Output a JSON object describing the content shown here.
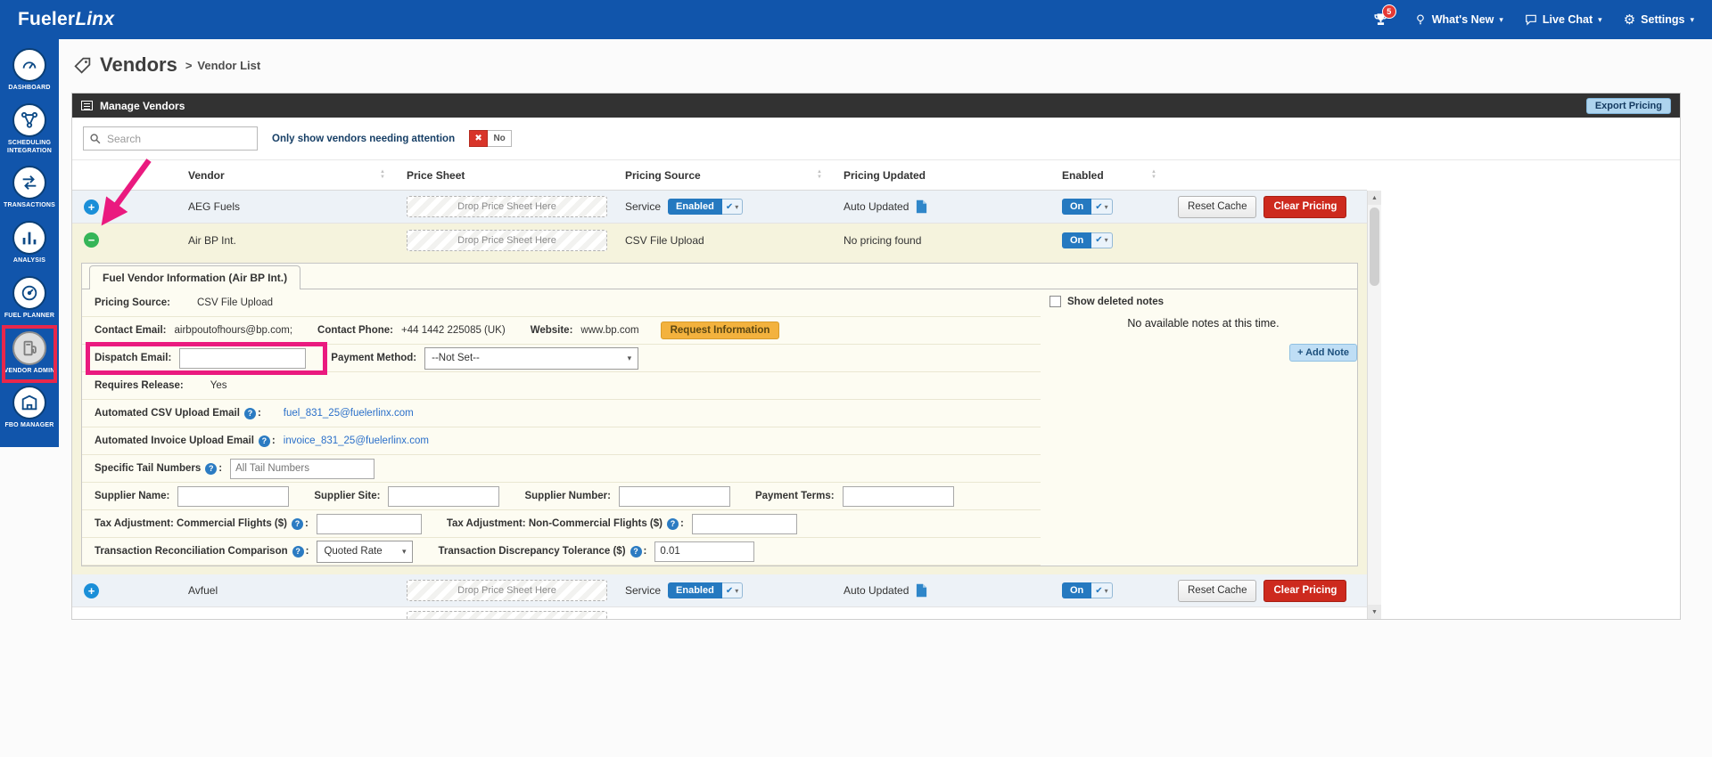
{
  "icons": {
    "sort_asc": "▲",
    "sort_desc": "▼",
    "caret": "▾",
    "check": "✔",
    "close": "✖",
    "plus": "+",
    "minus": "−",
    "help": "?",
    "gear": "⚙"
  },
  "annotations": {
    "color": "#ea1a7f"
  },
  "topbar": {
    "brand_bold": "Fueler",
    "brand_italic": "Linx",
    "badge_count": "5",
    "whats_new": "What's New",
    "live_chat": "Live Chat",
    "settings": "Settings"
  },
  "sidebar": {
    "items": [
      {
        "label": "DASHBOARD"
      },
      {
        "label": "SCHEDULING INTEGRATION"
      },
      {
        "label": "TRANSACTIONS"
      },
      {
        "label": "ANALYSIS"
      },
      {
        "label": "FUEL PLANNER"
      },
      {
        "label": "VENDOR ADMIN"
      },
      {
        "label": "FBO MANAGER"
      }
    ]
  },
  "breadcrumb": {
    "title": "Vendors",
    "separator": ">",
    "current": "Vendor List"
  },
  "manage": {
    "title": "Manage Vendors",
    "export_button": "Export Pricing",
    "search_placeholder": "Search",
    "attention_label": "Only show vendors needing attention",
    "attention_value": "No"
  },
  "table": {
    "headers": {
      "vendor": "Vendor",
      "price_sheet": "Price Sheet",
      "pricing_source": "Pricing Source",
      "pricing_updated": "Pricing Updated",
      "enabled": "Enabled"
    },
    "drop_zone_text": "Drop Price Sheet Here",
    "rows": [
      {
        "vendor": "AEG Fuels",
        "pricing_source": "Service",
        "source_badge": "Enabled",
        "pricing_updated": "Auto Updated",
        "enabled": "On",
        "reset_button": "Reset Cache",
        "clear_button": "Clear Pricing"
      },
      {
        "vendor": "Air BP Int.",
        "pricing_source": "CSV File Upload",
        "pricing_updated": "No pricing found",
        "enabled": "On"
      },
      {
        "vendor": "Avfuel",
        "pricing_source": "Service",
        "source_badge": "Enabled",
        "pricing_updated": "Auto Updated",
        "enabled": "On",
        "reset_button": "Reset Cache",
        "clear_button": "Clear Pricing"
      }
    ]
  },
  "detail": {
    "tab": "Fuel Vendor Information (Air BP Int.)",
    "colon": ":",
    "pricing_source_label": "Pricing Source:",
    "pricing_source_value": "CSV File Upload",
    "contact_email_label": "Contact Email:",
    "contact_email_value": "airbpoutofhours@bp.com;",
    "contact_phone_label": "Contact Phone:",
    "contact_phone_value": "+44 1442 225085 (UK)",
    "website_label": "Website:",
    "website_value": "www.bp.com",
    "request_button": "Request Information",
    "dispatch_email_label": "Dispatch Email:",
    "payment_method_label": "Payment Method:",
    "payment_method_value": "--Not Set--",
    "requires_release_label": "Requires Release:",
    "requires_release_value": "Yes",
    "auto_csv_label": "Automated CSV Upload Email",
    "auto_csv_value": "fuel_831_25@fuelerlinx.com",
    "auto_invoice_label": "Automated Invoice Upload Email",
    "auto_invoice_value": "invoice_831_25@fuelerlinx.com",
    "tail_label": "Specific Tail Numbers",
    "tail_placeholder": "All Tail Numbers",
    "supplier_name_label": "Supplier Name:",
    "supplier_site_label": "Supplier Site:",
    "supplier_number_label": "Supplier Number:",
    "payment_terms_label": "Payment Terms:",
    "tax_commercial_label": "Tax Adjustment: Commercial Flights ($)",
    "tax_non_commercial_label": "Tax Adjustment: Non-Commercial Flights ($)",
    "recon_label": "Transaction Reconciliation Comparison",
    "recon_value": "Quoted Rate",
    "tolerance_label": "Transaction Discrepancy Tolerance ($)",
    "tolerance_value": "0.01",
    "notes": {
      "show_deleted_label": "Show deleted notes",
      "empty_text": "No available notes at this time.",
      "add_button": "+ Add Note"
    }
  }
}
